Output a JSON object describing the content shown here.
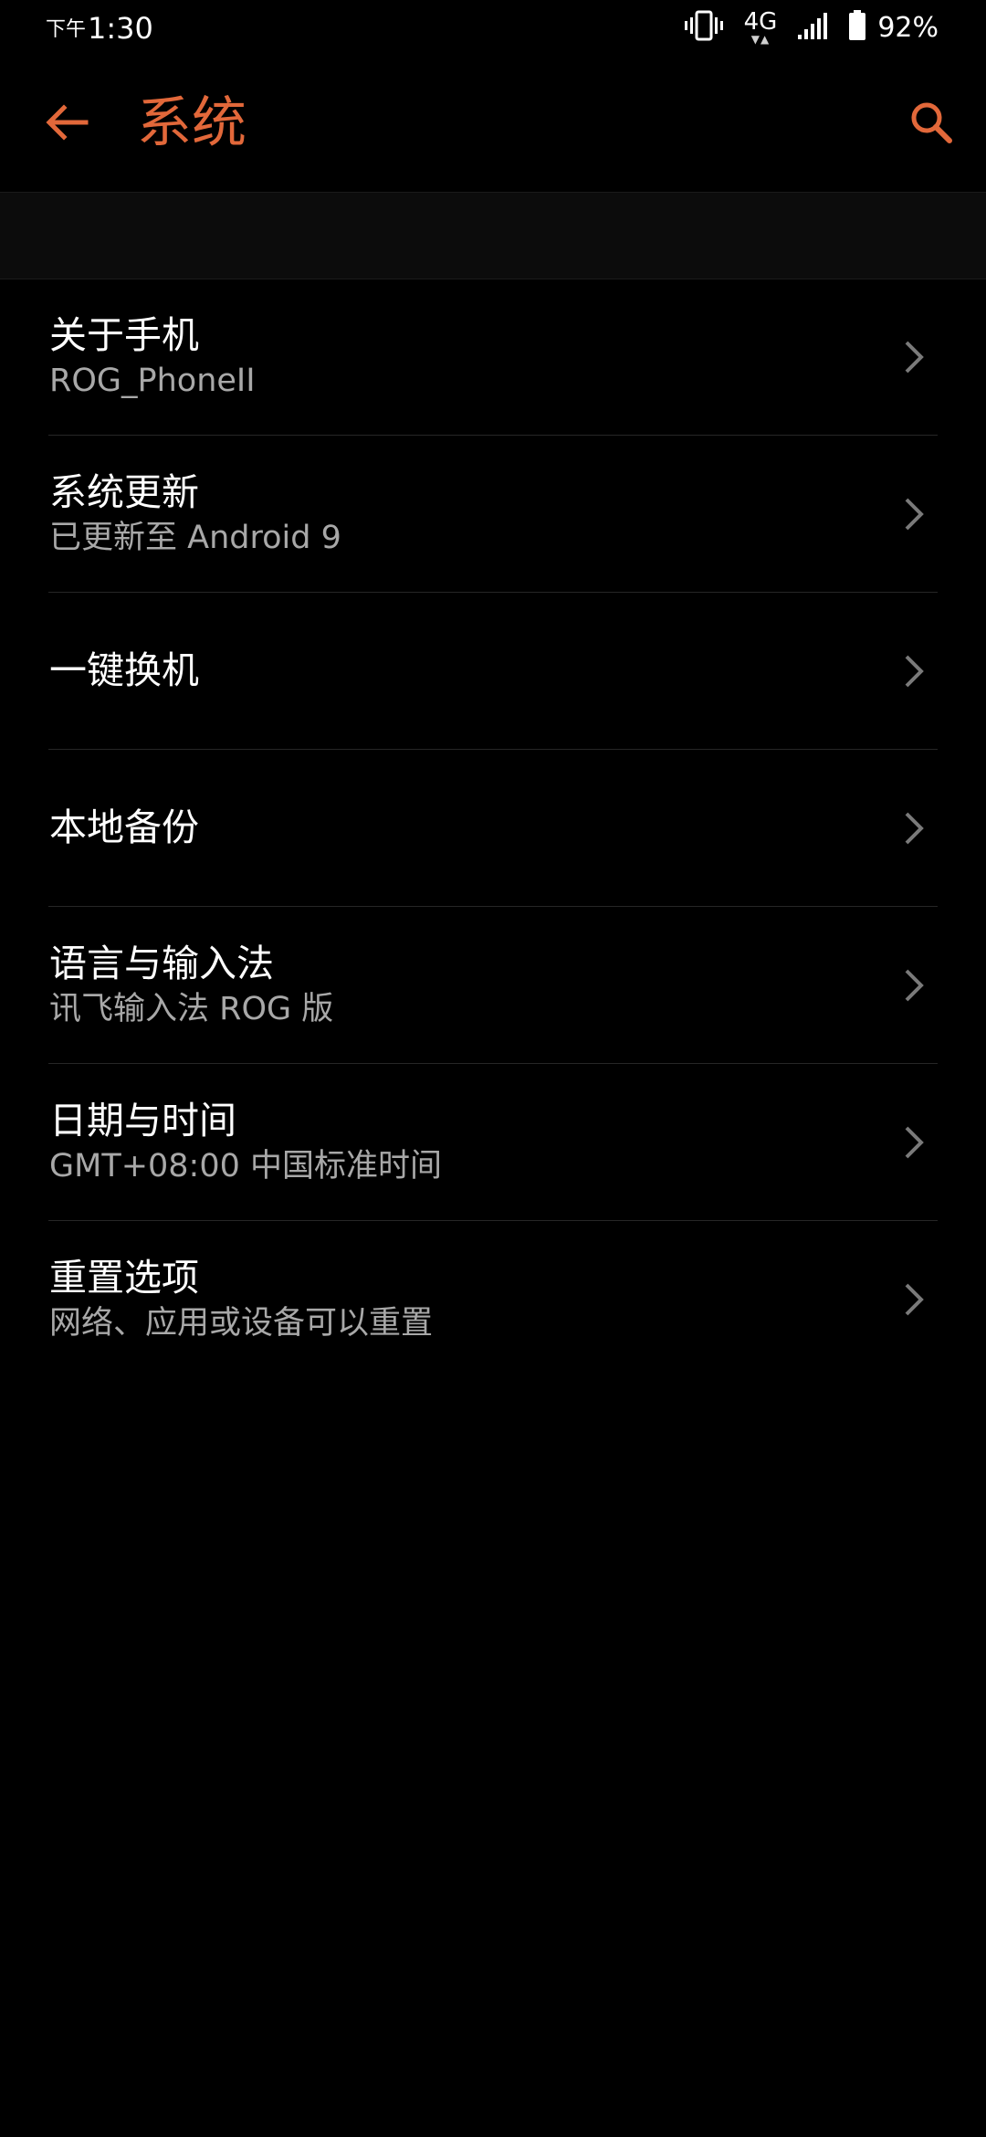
{
  "status_bar": {
    "ampm": "下午",
    "time": "1:30",
    "network": "4G",
    "battery": "92%"
  },
  "app_bar": {
    "title": "系统"
  },
  "colors": {
    "accent": "#e2683a",
    "background": "#000000",
    "subtitle": "#a8a8a8"
  },
  "items": [
    {
      "title": "关于手机",
      "subtitle": "ROG_PhoneII"
    },
    {
      "title": "系统更新",
      "subtitle": "已更新至 Android 9"
    },
    {
      "title": "一键换机",
      "subtitle": ""
    },
    {
      "title": "本地备份",
      "subtitle": ""
    },
    {
      "title": "语言与输入法",
      "subtitle": "讯飞输入法 ROG 版"
    },
    {
      "title": "日期与时间",
      "subtitle": "GMT+08:00 中国标准时间"
    },
    {
      "title": "重置选项",
      "subtitle": "网络、应用或设备可以重置"
    }
  ]
}
